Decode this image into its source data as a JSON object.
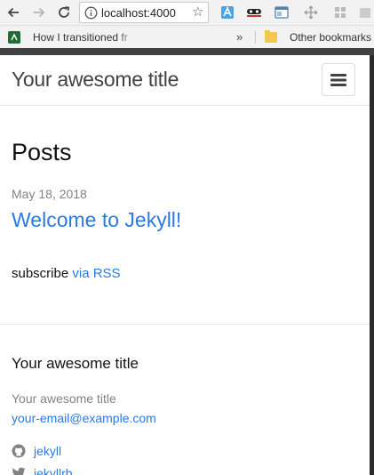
{
  "browser": {
    "url": "localhost:4000",
    "bookmarks": [
      {
        "label": "How I transitioned fr"
      },
      {
        "label": "Other bookmarks"
      }
    ],
    "overflow_chevron": "»"
  },
  "site": {
    "title": "Your awesome title"
  },
  "main": {
    "heading": "Posts",
    "posts": [
      {
        "date": "May 18, 2018",
        "title": "Welcome to Jekyll!"
      }
    ],
    "subscribe_text": "subscribe",
    "rss_link": "via RSS"
  },
  "footer": {
    "heading": "Your awesome title",
    "name": "Your awesome title",
    "email": "your-email@example.com",
    "social": [
      {
        "icon": "github-icon",
        "label": "jekyll"
      },
      {
        "icon": "twitter-icon",
        "label": "jekyllrb"
      }
    ]
  },
  "colors": {
    "link": "#2a7ae2",
    "meta": "#828282",
    "text": "#111111"
  }
}
